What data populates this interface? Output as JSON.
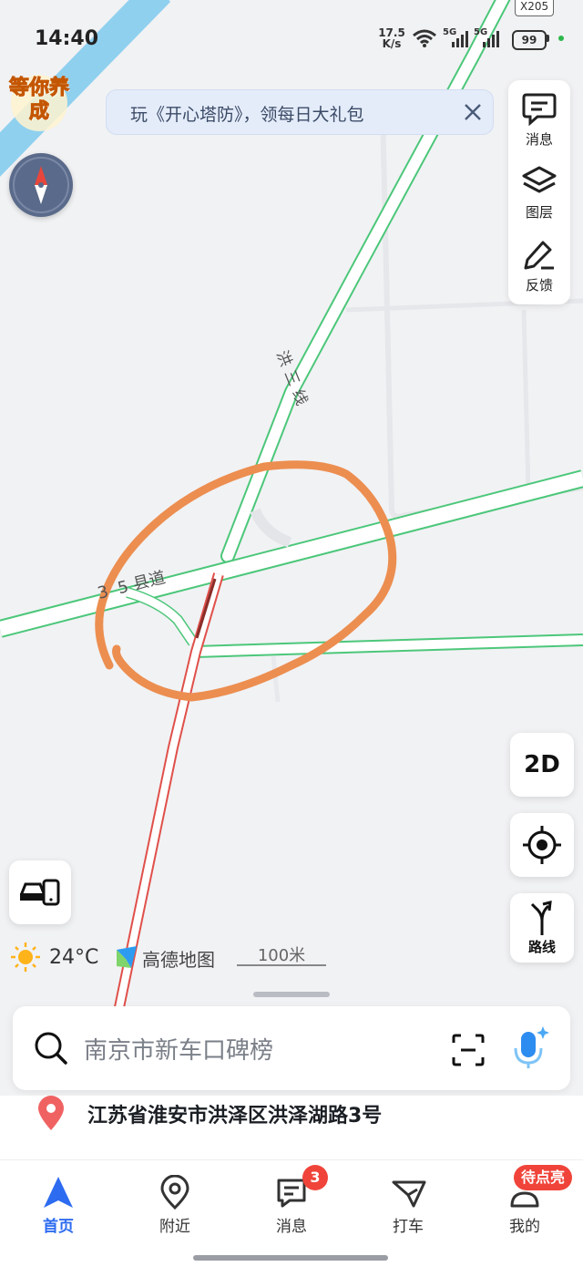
{
  "status_bar": {
    "time": "14:40",
    "net_speed_value": "17.5",
    "net_speed_unit": "K/s",
    "network_1": "5G",
    "network_2": "5G",
    "battery": "99"
  },
  "map": {
    "road_shield": "X205",
    "road_label_1": "洪三线",
    "road_label_2": "3  5 县道",
    "annotation_color": "#ec8e50",
    "road_green": "#4cc77a",
    "road_red": "#e0504a"
  },
  "promo": {
    "badge_text": "等你养成"
  },
  "banner": {
    "text": "玩《开心塔防》，领每日大礼包"
  },
  "tools": [
    {
      "label": "消息",
      "icon": "message-icon"
    },
    {
      "label": "图层",
      "icon": "layers-icon"
    },
    {
      "label": "反馈",
      "icon": "feedback-icon"
    }
  ],
  "controls": {
    "view_mode": "2D",
    "route_label": "路线"
  },
  "weather": {
    "temperature": "24°C",
    "icon": "sun-icon"
  },
  "brand": {
    "logo_text": "高德地图"
  },
  "scale": {
    "label": "100米"
  },
  "search": {
    "placeholder": "南京市新车口碑榜"
  },
  "location": {
    "address": "江苏省淮安市洪泽区洪泽湖路3号"
  },
  "tabs": [
    {
      "label": "首页",
      "icon": "navigate-arrow-icon",
      "active": true
    },
    {
      "label": "附近",
      "icon": "location-pin-icon",
      "active": false
    },
    {
      "label": "消息",
      "icon": "chat-icon",
      "active": false,
      "badge": "3"
    },
    {
      "label": "打车",
      "icon": "taxi-flag-icon",
      "active": false
    },
    {
      "label": "我的",
      "icon": "profile-icon",
      "active": false,
      "pill": "待点亮"
    }
  ],
  "accent_color": "#2d6cf0"
}
